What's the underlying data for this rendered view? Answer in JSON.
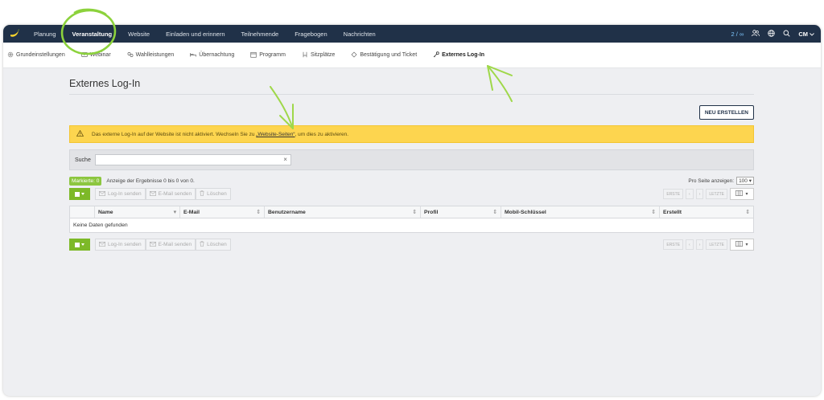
{
  "topnav": {
    "items": [
      "Planung",
      "Veranstaltung",
      "Website",
      "Einladen und erinnern",
      "Teilnehmende",
      "Fragebogen",
      "Nachrichten"
    ],
    "active_index": 1,
    "count": "2 / ∞",
    "user": "CM"
  },
  "subnav": {
    "items": [
      {
        "label": "Grundeinstellungen",
        "icon": "gear-icon"
      },
      {
        "label": "Webinar",
        "icon": "video-icon"
      },
      {
        "label": "Wahlleistungen",
        "icon": "options-icon"
      },
      {
        "label": "Übernachtung",
        "icon": "bed-icon"
      },
      {
        "label": "Programm",
        "icon": "calendar-icon"
      },
      {
        "label": "Sitzplätze",
        "icon": "seat-icon"
      },
      {
        "label": "Bestätigung und Ticket",
        "icon": "ticket-icon"
      },
      {
        "label": "Externes Log-In",
        "icon": "key-icon"
      }
    ],
    "active_index": 7
  },
  "page": {
    "title": "Externes Log-In",
    "new_button": "NEU ERSTELLEN"
  },
  "alert": {
    "text_before": "Das externe Log-In auf der Website ist nicht aktiviert. Wechseln Sie zu ",
    "link": "„Website-Seiten“",
    "text_after": ", um dies zu aktivieren."
  },
  "search": {
    "label": "Suche",
    "value": ""
  },
  "results": {
    "selected_badge": "Markierte: 0",
    "summary": "Anzeige der Ergebnisse 0 bis 0 von 0.",
    "per_page_label": "Pro Seite anzeigen:",
    "per_page_value": "100"
  },
  "toolbar": {
    "login_send": "Log-In senden",
    "email_send": "E-Mail senden",
    "delete": "Löschen"
  },
  "pager": {
    "first": "ERSTE",
    "prev": "‹",
    "next": "›",
    "last": "LETZTE"
  },
  "table": {
    "columns": [
      "Name",
      "E-Mail",
      "Benutzername",
      "Profil",
      "Mobil-Schlüssel",
      "Erstellt"
    ],
    "empty": "Keine Daten gefunden"
  }
}
